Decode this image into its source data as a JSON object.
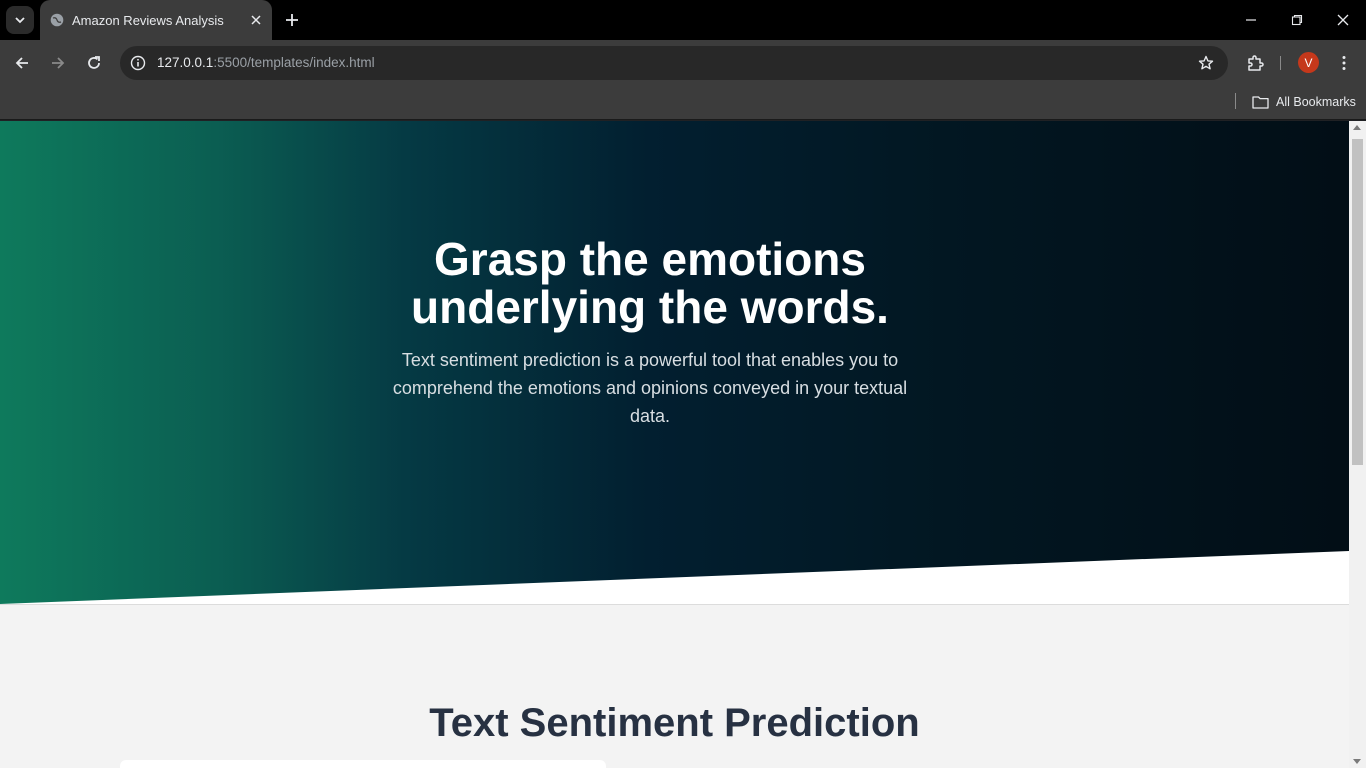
{
  "browser": {
    "tab": {
      "title": "Amazon Reviews Analysis",
      "favicon": "globe-icon"
    },
    "url": {
      "host": "127.0.0.1",
      "rest": ":5500/templates/index.html"
    },
    "avatar_letter": "V",
    "bookmarks": {
      "all_label": "All Bookmarks"
    },
    "colors": {
      "titlebar": "#000000",
      "toolbar": "#3c3c3c",
      "avatar": "#c5381b"
    }
  },
  "hero": {
    "title_line1": "Grasp the emotions",
    "title_line2": "underlying the words.",
    "subtitle": "Text sentiment prediction is a powerful tool that enables you to comprehend the emotions and opinions conveyed in your textual data.",
    "gradient": [
      "#0e7a5c",
      "#021f30",
      "#020e16"
    ]
  },
  "section": {
    "title": "Text Sentiment Prediction"
  }
}
